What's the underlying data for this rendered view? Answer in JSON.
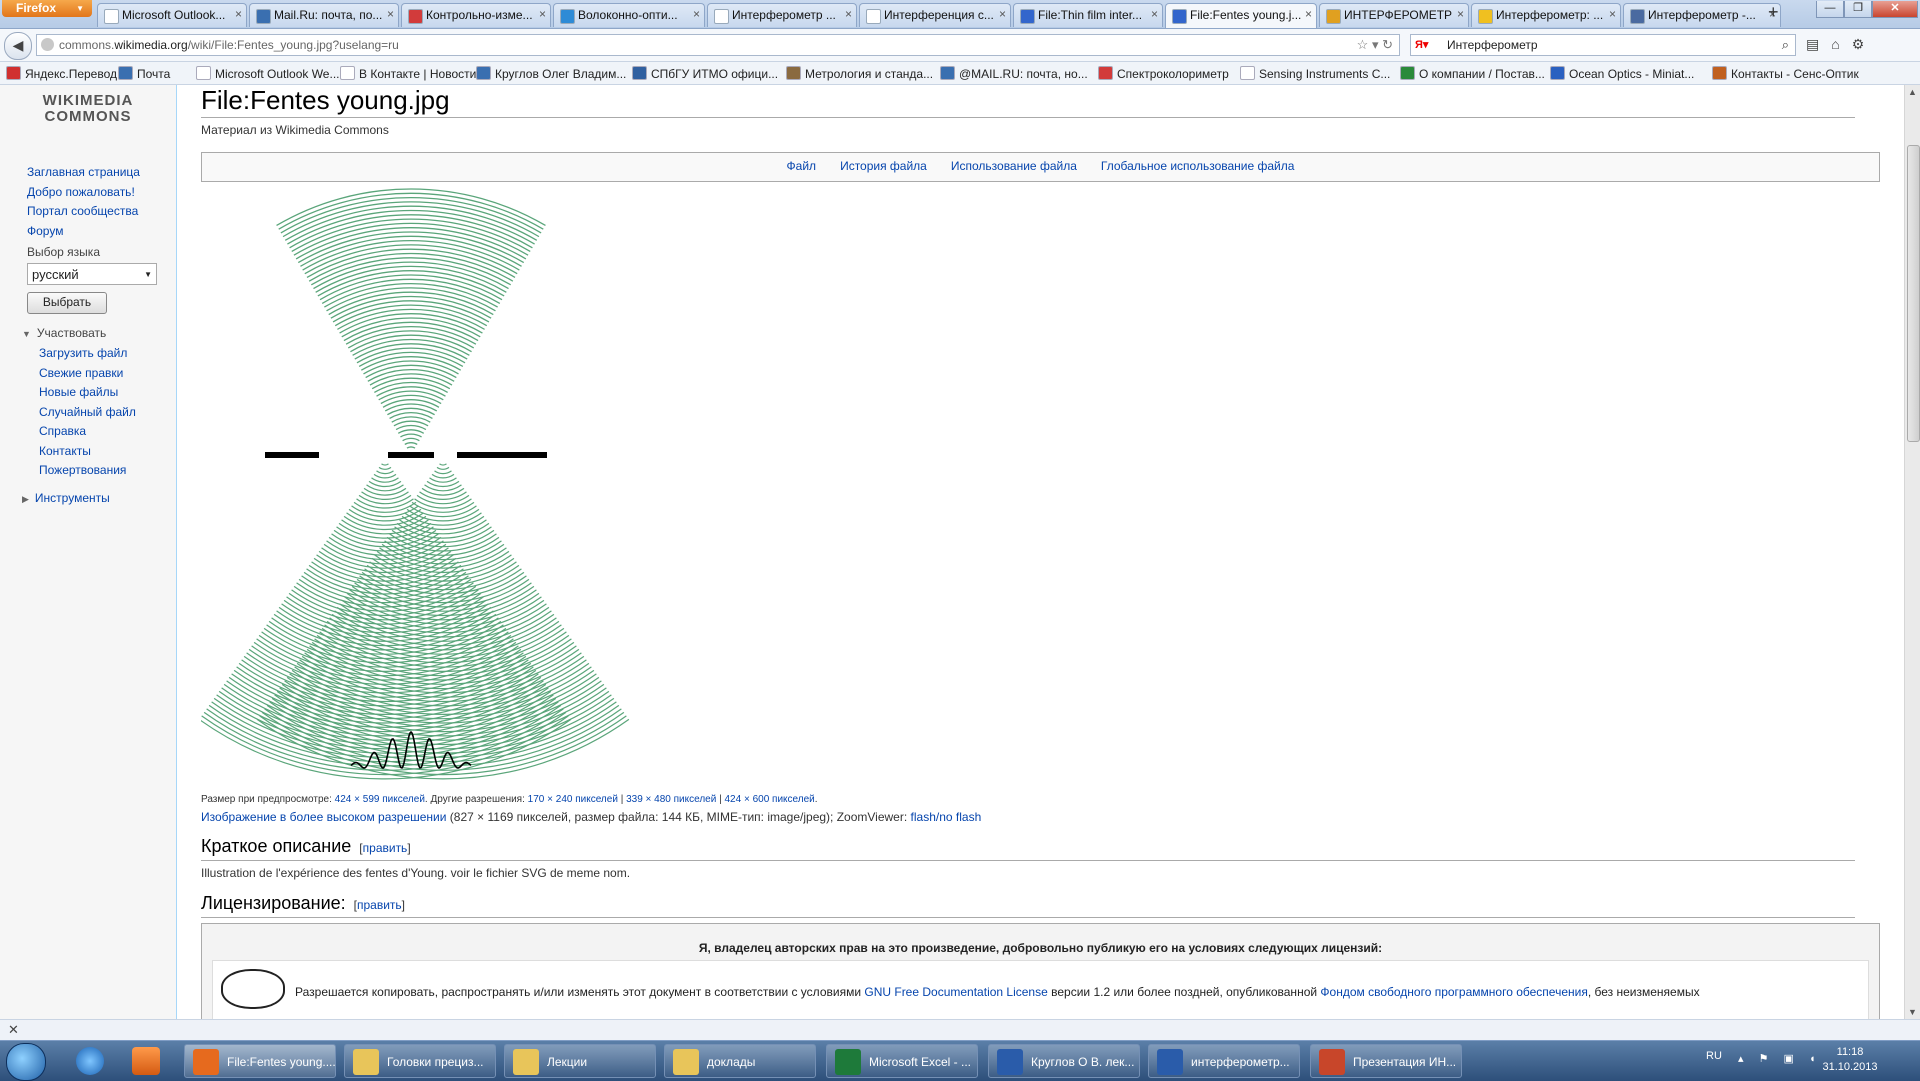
{
  "browser": {
    "menu_button": "Firefox",
    "tabs": [
      {
        "label": "Microsoft Outlook...",
        "color": "#ffffff",
        "active": false
      },
      {
        "label": "Mail.Ru: почта, по...",
        "color": "#3a6fb0",
        "active": false
      },
      {
        "label": "Контрольно-изме...",
        "color": "#d23b3b",
        "active": false
      },
      {
        "label": "Волоконно-опти...",
        "color": "#2e8bd6",
        "active": false
      },
      {
        "label": "Интерферометр ...",
        "color": "#ffffff",
        "active": false
      },
      {
        "label": "Интерференция с...",
        "color": "#ffffff",
        "active": false
      },
      {
        "label": "File:Thin film inter...",
        "color": "#3366cc",
        "active": false
      },
      {
        "label": "File:Fentes young.j...",
        "color": "#3366cc",
        "active": true
      },
      {
        "label": "ИНТЕРФЕРОМЕТР",
        "color": "#e0a020",
        "active": false
      },
      {
        "label": "Интерферометр: ...",
        "color": "#f0c020",
        "active": false
      },
      {
        "label": "Интерферометр -...",
        "color": "#4a6aa0",
        "active": false
      }
    ],
    "url_host": "commons.wikimedia.org",
    "url_prefix": "commons.",
    "url_domain": "wikimedia.org",
    "url_path": "/wiki/File:Fentes_young.jpg?uselang=ru",
    "search_value": "Интерферометр",
    "bookmarks": [
      "Яндекс.Перевод",
      "Почта",
      "Microsoft Outlook We...",
      "В Контакте | Новости",
      "Круглов Олег Владим...",
      "СПбГУ ИТМО офици...",
      "Метрология и станда...",
      "@MAIL.RU: почта, но...",
      "Спектроколориметр",
      "Sensing Instruments C...",
      "О компании / Постав...",
      "Ocean Optics - Miniat...",
      "Контакты - Сенс-Оптик"
    ]
  },
  "sidebar": {
    "logo_line1": "WIKIMEDIA",
    "logo_line2": "COMMONS",
    "nav": [
      "Заглавная страница",
      "Добро пожаловать!",
      "Портал сообщества",
      "Форум"
    ],
    "lang_label": "Выбор языка",
    "lang_value": "русский",
    "lang_button": "Выбрать",
    "participate_label": "Участвовать",
    "participate_items": [
      "Загрузить файл",
      "Свежие правки",
      "Новые файлы",
      "Случайный файл",
      "Справка",
      "Контакты",
      "Пожертвования"
    ],
    "tools_label": "Инструменты"
  },
  "content": {
    "title": "File:Fentes young.jpg",
    "site_sub": "Материал из Wikimedia Commons",
    "toc": [
      "Файл",
      "История файла",
      "Использование файла",
      "Глобальное использование файла"
    ],
    "preview_label": "Размер при предпросмотре:",
    "preview_size": "424 × 599 пикселей",
    "other_res_label": ". Другие разрешения:",
    "res_1": "170 × 240 пикселей",
    "res_2": "339 × 480 пикселей",
    "res_3": "424 × 600 пикселей",
    "fullres_link": "Изображение в более высоком разрешении",
    "fullres_info": " (827 × 1169 пикселей, размер файла: 144 КБ, MIME-тип: image/jpeg); ZoomViewer: ",
    "zoom_link": "flash/no flash",
    "h2_summary": "Краткое описание",
    "h2_licensing": "Лицензирование:",
    "edit_link": "править",
    "description": "Illustration de l'expérience des fentes d'Young. voir le fichier SVG de meme nom.",
    "license_title": "Я, владелец авторских прав на это произведение, добровольно публикую его на условиях следующих лицензий:",
    "license_text_1": "Разрешается копировать, распространять и/или изменять этот документ в соответствии с условиями ",
    "license_link_1": "GNU Free Documentation License",
    "license_text_2": " версии 1.2 или более поздней, опубликованной ",
    "license_link_2": "Фондом свободного программного обеспечения",
    "license_text_3": ", без неизменяемых",
    "wave_color": "#5aa57a"
  },
  "taskbar": {
    "items": [
      {
        "label": "File:Fentes young....",
        "color": "#e66a1e",
        "active": true
      },
      {
        "label": "Головки  прециз...",
        "color": "#e8c55a",
        "active": false
      },
      {
        "label": "Лекции",
        "color": "#e8c55a",
        "active": false
      },
      {
        "label": "доклады",
        "color": "#e8c55a",
        "active": false
      },
      {
        "label": "Microsoft Excel - ...",
        "color": "#1e7a3a",
        "active": false
      },
      {
        "label": "Круглов О В. лек...",
        "color": "#2a5caa",
        "active": false
      },
      {
        "label": "интерферометр...",
        "color": "#2a5caa",
        "active": false
      },
      {
        "label": "Презентация ИН...",
        "color": "#c8462a",
        "active": false
      }
    ],
    "lang": "RU",
    "time": "11:18",
    "date": "31.10.2013"
  }
}
